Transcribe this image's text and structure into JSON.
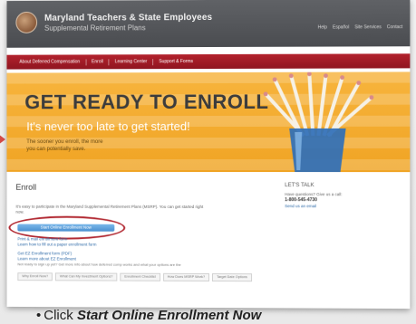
{
  "header": {
    "brand_line1": "Maryland Teachers & State Employees",
    "brand_line2": "Supplemental Retirement Plans",
    "utility_links": [
      "Help",
      "Español",
      "Site Services",
      "Contact"
    ]
  },
  "nav": {
    "items": [
      "About Deferred Compensation",
      "Enroll",
      "Learning Center",
      "Support & Forms"
    ]
  },
  "hero": {
    "title": "GET READY TO ENROLL",
    "subtitle": "It's never too late to get started!",
    "small_line1": "The sooner you enroll, the more",
    "small_line2": "you can potentially save."
  },
  "content": {
    "heading": "Enroll",
    "intro": "It's easy to participate in the Maryland Supplemental Retirement Plans (MSRP). You can get started right",
    "intro2": "now.",
    "start_button": "Start Online Enrollment Now",
    "links": [
      "Print & mail enrollment form",
      "Learn how to fill out a paper enrollment form"
    ],
    "links2": [
      "Get EZ Enrollment form (PDF)",
      "Learn more about EZ Enrollment"
    ],
    "bottom_note": "Not ready to sign up yet? Get more info about how deferred comp works and what your options are the",
    "tabs": [
      "Why Enroll Now?",
      "What Can My Investment Options?",
      "Enrollment Checklist",
      "How Does MSRP Work?",
      "Target Date Options"
    ]
  },
  "sidebar": {
    "heading": "LET'S TALK",
    "line1": "Have questions? Give us a call:",
    "phone": "1-800-545-4730",
    "link": "Send us an email"
  },
  "caption": {
    "bullet": "•",
    "prefix": "Click ",
    "emphasis": "Start Online Enrollment Now"
  },
  "colors": {
    "nav_red": "#a01c27",
    "hero_orange": "#f5ad34",
    "button_blue": "#5a9fdc",
    "ring_red": "#b22a33"
  }
}
